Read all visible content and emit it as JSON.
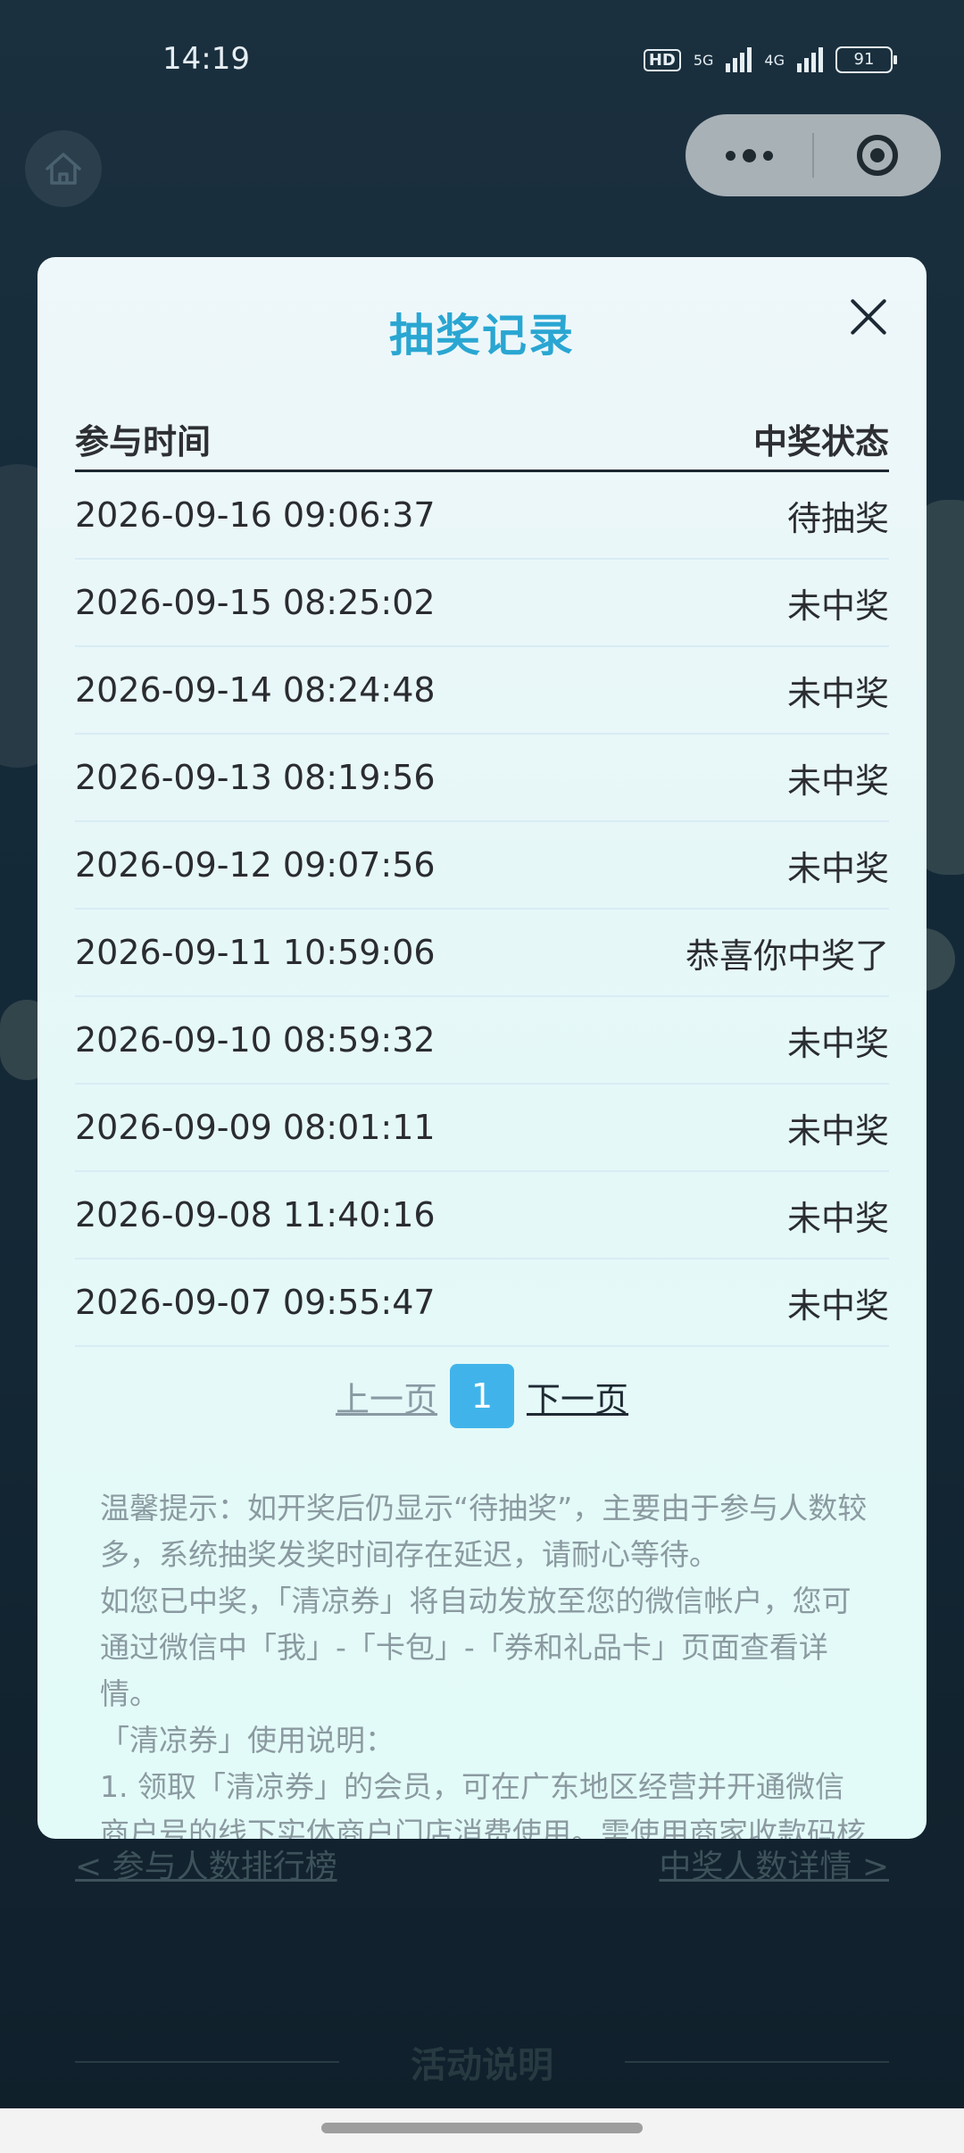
{
  "status_bar": {
    "time": "14:19",
    "hd": "HD",
    "net1": "5G",
    "net2": "4G",
    "battery": "91"
  },
  "modal": {
    "title": "抽奖记录",
    "headers": {
      "time": "参与时间",
      "status": "中奖状态"
    },
    "rows": [
      {
        "time": "2026-09-16 09:06:37",
        "status": "待抽奖"
      },
      {
        "time": "2026-09-15 08:25:02",
        "status": "未中奖"
      },
      {
        "time": "2026-09-14 08:24:48",
        "status": "未中奖"
      },
      {
        "time": "2026-09-13 08:19:56",
        "status": "未中奖"
      },
      {
        "time": "2026-09-12 09:07:56",
        "status": "未中奖"
      },
      {
        "time": "2026-09-11 10:59:06",
        "status": "恭喜你中奖了"
      },
      {
        "time": "2026-09-10 08:59:32",
        "status": "未中奖"
      },
      {
        "time": "2026-09-09 08:01:11",
        "status": "未中奖"
      },
      {
        "time": "2026-09-08 11:40:16",
        "status": "未中奖"
      },
      {
        "time": "2026-09-07 09:55:47",
        "status": "未中奖"
      }
    ],
    "pager": {
      "prev": "上一页",
      "current": "1",
      "next": "下一页"
    },
    "tips": [
      "温馨提示：如开奖后仍显示“待抽奖”，主要由于参与人数较多，系统抽奖发奖时间存在延迟，请耐心等待。",
      "如您已中奖，「清凉券」将自动发放至您的微信帐户，您可通过微信中「我」-「卡包」-「券和礼品卡」页面查看详情。",
      "「清凉券」使用说明：",
      "1. 领取「清凉券」的会员，可在广东地区经营并开通微信商户号的线下实体商户门店消费使用。需使用商家收款码核"
    ]
  },
  "background": {
    "left_link": "< 参与人数排行榜",
    "right_link": "中奖人数详情 >",
    "section_title": "活动说明"
  }
}
